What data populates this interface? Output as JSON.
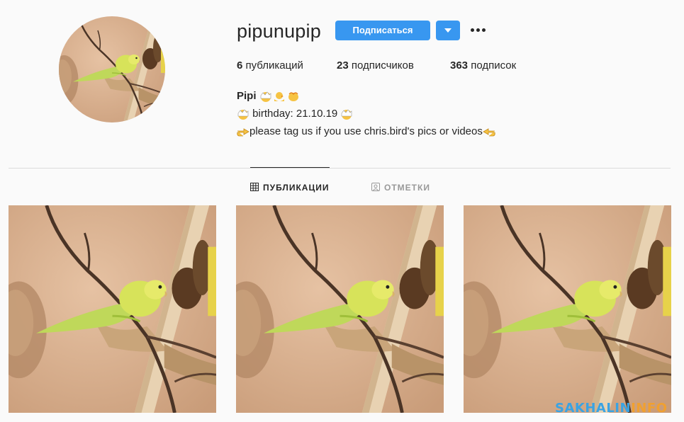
{
  "profile": {
    "username": "pipunupip",
    "follow_label": "Подписаться",
    "stats": {
      "posts_count": "6",
      "posts_label": "публикаций",
      "followers_count": "23",
      "followers_label": "подписчиков",
      "following_count": "363",
      "following_label": "подписок"
    },
    "bio": {
      "name": "Pipi",
      "birthday": "birthday: 21.10.19",
      "tag_line": "please tag us if you use chris.bird's pics or videos"
    }
  },
  "tabs": [
    {
      "label": "ПУБЛИКАЦИИ",
      "icon": "grid-icon",
      "active": true
    },
    {
      "label": "ОТМЕТКИ",
      "icon": "tag-person-icon",
      "active": false
    }
  ],
  "posts": [
    {
      "image": "budgerigar-on-branch"
    },
    {
      "image": "budgerigar-on-branch"
    },
    {
      "image": "budgerigar-on-branch"
    }
  ],
  "watermark": {
    "part1": "SAKHALIN",
    "part2": "INFO",
    "color1": "#3aa3e3",
    "color2": "#f0a030"
  },
  "colors": {
    "accent": "#3897f0",
    "background": "#fafafa",
    "text": "#262626",
    "muted": "#999999"
  }
}
